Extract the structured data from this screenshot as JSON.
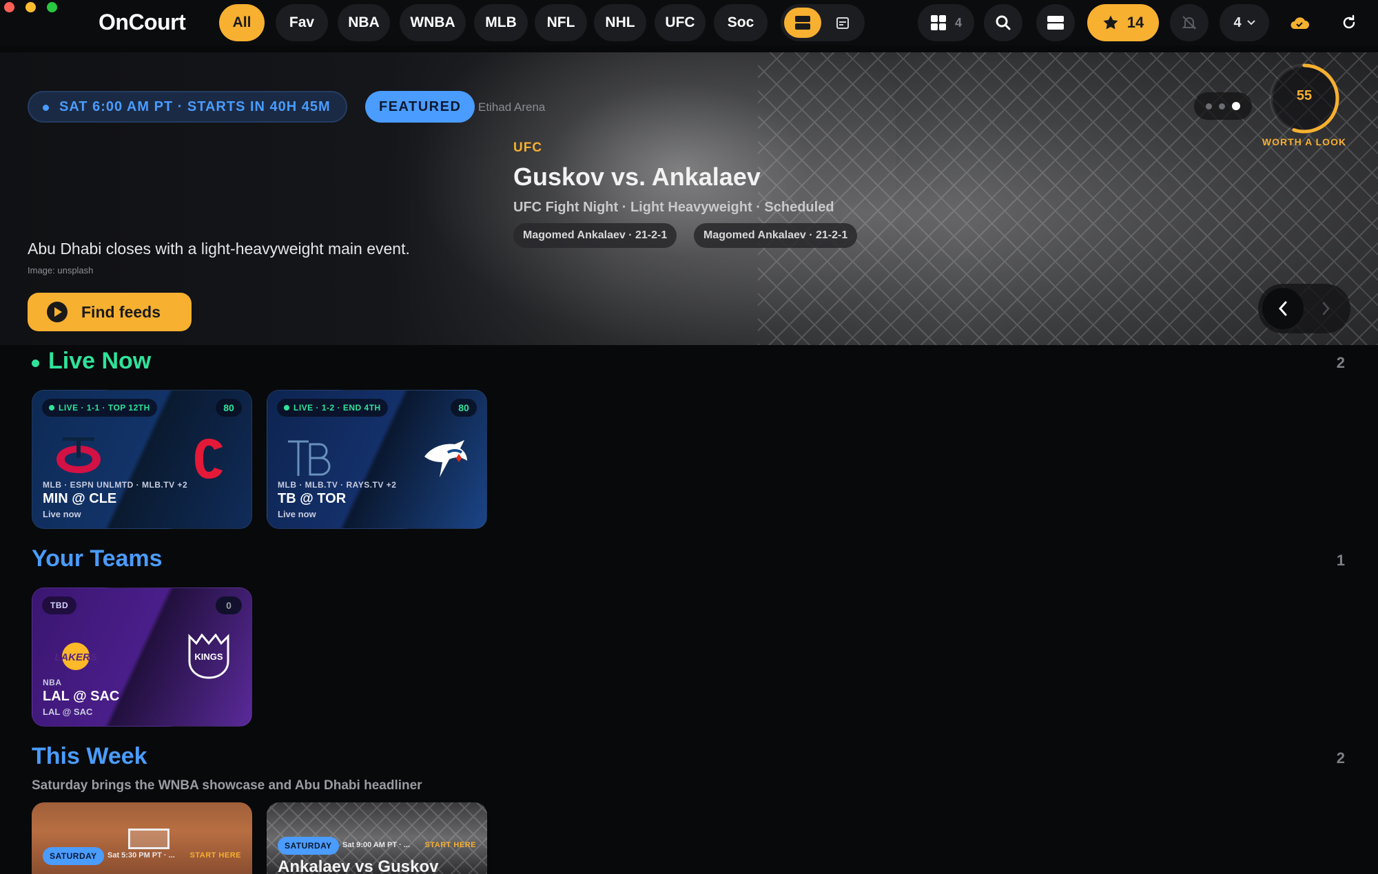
{
  "app": {
    "name": "OnCourt"
  },
  "nav": {
    "filters": [
      "All",
      "Fav",
      "NBA",
      "WNBA",
      "MLB",
      "NFL",
      "NHL",
      "UFC",
      "Soc"
    ],
    "active_filter": "All",
    "grid_count": "4",
    "favorites_count": "14",
    "layout_count": "4"
  },
  "hero": {
    "time_label": "SAT 6:00 AM PT · STARTS IN 40H 45M",
    "badge": "FEATURED",
    "venue": "Etihad Arena",
    "sport": "UFC",
    "title": "Guskov vs. Ankalaev",
    "meta": "UFC Fight Night · Light Heavyweight · Scheduled",
    "fighters": [
      "Magomed Ankalaev · 21-2-1",
      "Magomed Ankalaev · 21-2-1"
    ],
    "description": "Abu Dhabi closes with a light-heavyweight main event.",
    "image_credit": "Image: unsplash",
    "cta": "Find feeds",
    "score": "55",
    "score_fraction": 0.55,
    "score_label": "WORTH A LOOK",
    "slide_index": 3,
    "slide_count": 3
  },
  "sections": {
    "live": {
      "title": "Live Now",
      "count": "2",
      "cards": [
        {
          "status": "LIVE · 1-1 · TOP 12TH",
          "score": "80",
          "league": "MLB · ESPN UNLMTD · MLB.TV +2",
          "matchup": "MIN @ CLE",
          "sub": "Live now"
        },
        {
          "status": "LIVE · 1-2 · END 4TH",
          "score": "80",
          "league": "MLB · MLB.TV · RAYS.TV +2",
          "matchup": "TB @ TOR",
          "sub": "Live now"
        }
      ]
    },
    "teams": {
      "title": "Your Teams",
      "count": "1",
      "cards": [
        {
          "status": "TBD",
          "score": "0",
          "league": "NBA",
          "matchup": "LAL @ SAC",
          "sub": "LAL @ SAC",
          "home_logo_text": "LAKERS",
          "away_logo_text": "KINGS"
        }
      ]
    },
    "week": {
      "title": "This Week",
      "count": "2",
      "subtitle": "Saturday brings the WNBA showcase and Abu Dhabi headliner",
      "cards": [
        {
          "tag": "SATURDAY",
          "time": "Sat 5:30 PM PT · ...",
          "start": "START HERE",
          "title": ""
        },
        {
          "tag": "SATURDAY",
          "time": "Sat 9:00 AM PT · ...",
          "start": "START HERE",
          "title": "Ankalaev vs Guskov"
        }
      ]
    }
  },
  "colors": {
    "accent": "#f7b030",
    "blue": "#4a9cff",
    "live": "#2fe39a",
    "background": "#08090b"
  }
}
